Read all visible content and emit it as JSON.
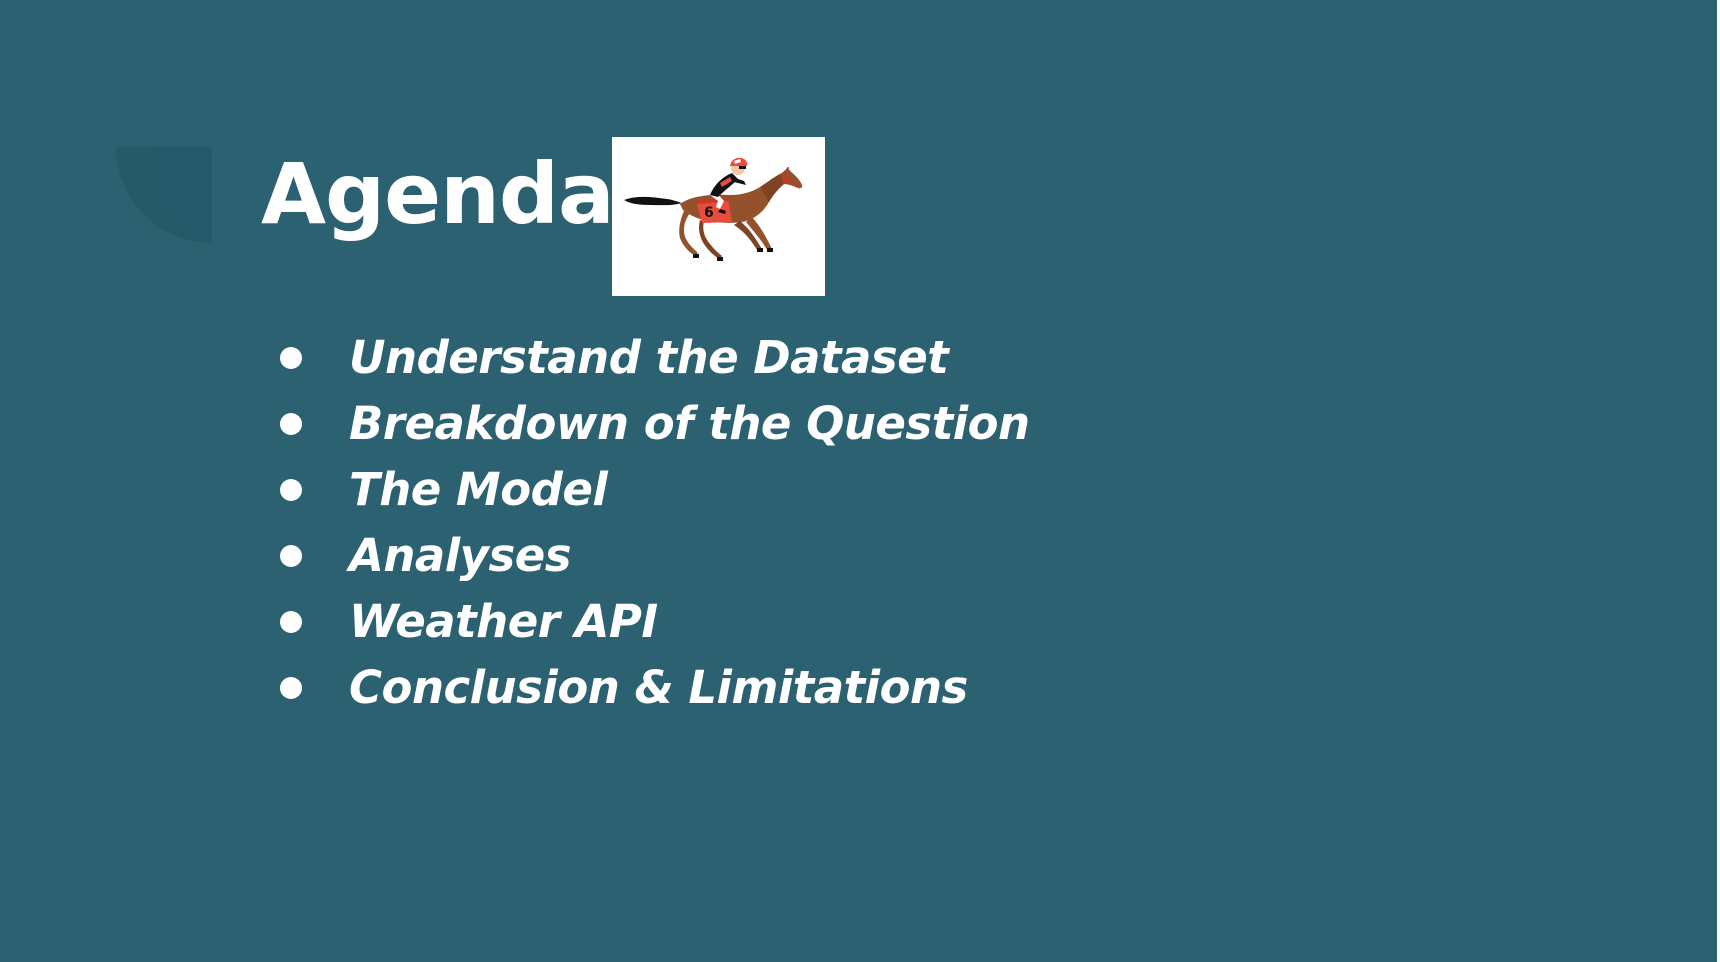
{
  "slide": {
    "title": "Agenda",
    "background_color": "#2b6171",
    "text_color": "#ffffff",
    "image": {
      "icon": "horse-racing-jockey-icon",
      "saddle_cloth_number": "6"
    },
    "items": [
      {
        "label": "Understand the Dataset"
      },
      {
        "label": "Breakdown of the Question"
      },
      {
        "label": "The Model"
      },
      {
        "label": "Analyses"
      },
      {
        "label": "Weather API"
      },
      {
        "label": "Conclusion & Limitations"
      }
    ]
  }
}
